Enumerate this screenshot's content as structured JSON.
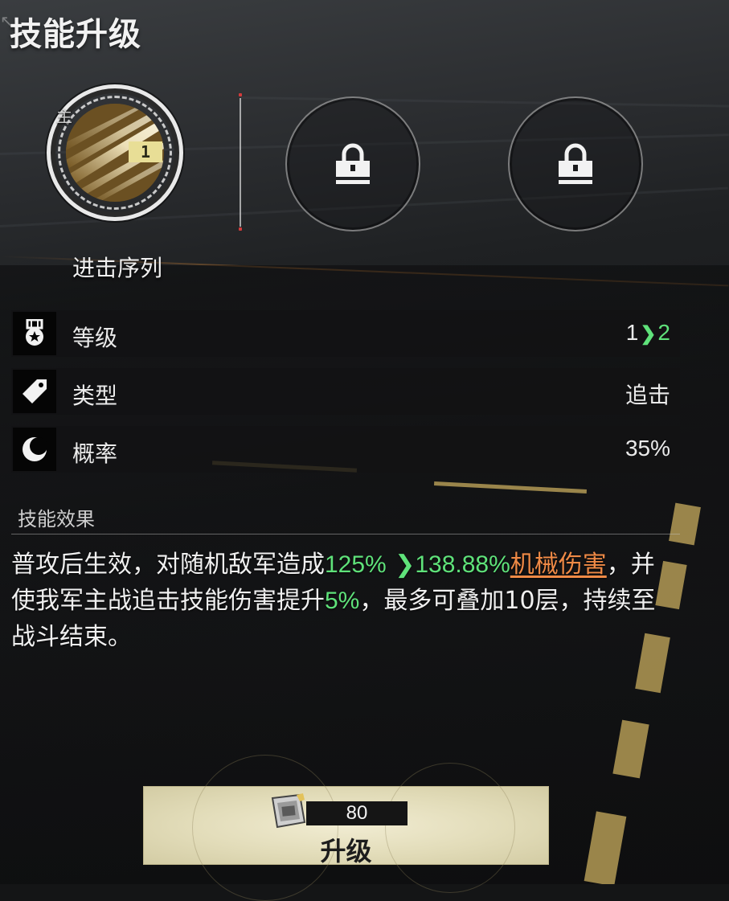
{
  "header": {
    "title": "技能升级"
  },
  "skill_slots": {
    "main": {
      "tag": "主",
      "name": "进击序列",
      "level": "1"
    },
    "locked_slots": [
      {
        "state": "locked",
        "icon": "lock-icon"
      },
      {
        "state": "locked",
        "icon": "lock-icon"
      }
    ]
  },
  "stats": {
    "level": {
      "label": "等级",
      "icon": "medal-icon",
      "from": "1",
      "to": "2"
    },
    "type": {
      "label": "类型",
      "icon": "tag-icon",
      "value": "追击"
    },
    "chance": {
      "label": "概率",
      "icon": "moon-icon",
      "value": "35%"
    }
  },
  "effect": {
    "title": "技能效果",
    "line_part1": "普攻后生效，对随机敌军造成",
    "from_pct": "125%",
    "to_pct": "138.88%",
    "damage_type": "机械伤害",
    "line_part2": "，并使我军主战追击技能伤害提升",
    "buff_pct": "5%",
    "line_part3": "，最多可叠加10层，持续至战斗结束。"
  },
  "upgrade": {
    "cost": "80",
    "label": "升级",
    "currency_icon": "chip-icon"
  },
  "colors": {
    "highlight_green": "#5fe27a",
    "damage_orange": "#ef8a46",
    "badge_yellow": "#e8de96",
    "button_bg": "#e2dcb9"
  }
}
